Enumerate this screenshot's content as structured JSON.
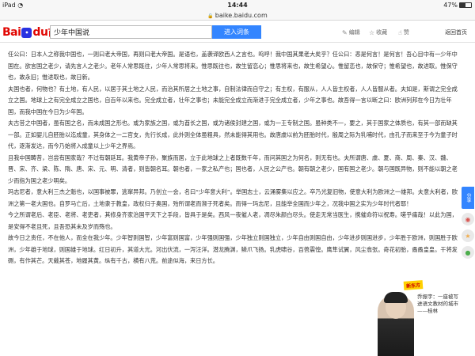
{
  "status_bar": {
    "device": "iPad",
    "wifi_icon": "wifi-icon",
    "time": "14:44",
    "battery_percent": "47%",
    "battery_level": 0.47
  },
  "url_bar": {
    "url": "baike.baidu.com"
  },
  "header": {
    "logo_bai": "Bai",
    "logo_du": "du",
    "logo_baike": "百科",
    "search_value": "少年中国说",
    "search_button": "进入词条",
    "edit_label": "编辑",
    "collect_label": "收藏",
    "like_label": "赞",
    "back_home": "返回首页"
  },
  "article": {
    "paragraphs": [
      "任公曰：日本人之称我中国也，一则曰老大帝国，再则曰老大帝国。是语也，盖袭译欧西人之言也。呜呼！我中国其果老大矣乎？任公曰：恶是何言！是何言！吾心目中有一少年中国在。欲言国之老少，请先言人之老少。老年人常思既往，少年人常思将来。惟思既往也，故生留恋心；惟思将来也，故生希望心。惟留恋也，故保守；惟希望也，故进取。惟保守也，故永旧；惟进取也，故日新。",
      "夫国也者，何物也？有土地，有人民，以居于其土地之人民，而治其所居之土地之事，自制法律而自守之；有主权，有服从，人人皆主权者，人人皆服从者。夫如是，斯谓之完全成立之国。地球上之有完全成立之国也，自百年以来也。完全成立者，壮年之事也；未能完全成立而渐进于完全成立者，少年之事也。故吾得一言以断之曰：欧洲列邦在今日为壮年国，而我中国在今日为少年国。",
      "夫古昔之中国者，虽有国之名，而未成国之形也。或为家族之国，或为酋长之国，或为诸侯封建之国，或为一王专制之国。虽种类不一，要之，其于国家之体质也，有其一部而缺其一部。正如婴儿自胚胎以迄成童，其身体之一二官支，先行长成，此外则全体虽粗具，然未能得其用也。故唐虞以前为胚胎时代，殷周之际为乳哺时代，由孔子而来至于今为童子时代，逐渐发达，而今乃始将入成童以上少年之界焉。",
      "且我中国畴昔，岂尝有国家哉？不过有朝廷耳。我黄帝子孙，聚族而居，立于此地球之上者既数千年，而问其国之为何名，则无有也。夫所谓唐、虞、夏、商、周、秦、汉、魏、晋、宋、齐、梁、陈、隋、唐、宋、元、明、清者，则皆朝名耳。朝也者，一家之私产也；国也者，人民之公产也。朝有朝之老少，国有国之老少。朝与国既异物，则不能以朝之老少而指为国之老少明矣。",
      "玛志尼者，意大利三杰之魁也，以国事被罪，逃窜异邦。乃创立一会，名曰“少年意大利”。举国志士，云涌雾集以应之。卒乃光复旧物，使意大利为欧洲之一雄邦。夫意大利者，欧洲之第一老大国也。自罗马亡后，土地隶于教皇，政权归于奥国，殆所谓老而濒于死者矣。而得一玛志尼，且能举全国而少年之，况我中国之实为少年时代者耶！",
      "今之所谓老后、老臣、老将、老吏者，其修身齐家治国平天下之手段，皆具于是矣。西风一夜催人老，凋尽朱颜白尽头。使走无常当医生，携催命符以祝寿。嗟乎痛哉！以此为国，是安得不老且死，且吾恐其未及岁而殇也。",
      "故今日之责任，不在他人，而全在我少年。少年智则国智，少年富则国富，少年强则国强，少年独立则国独立，少年自由则国自由，少年进步则国进步，少年胜于欧洲，则国胜于欧洲，少年雄于地球，则国雄于地球。红日初升，其道大光。河出伏流，一泻汪洋。潜龙腾渊，鳞爪飞扬。乳虎啸谷，百兽震惶。鹰隼试翼，风尘翕张。奇花初胎，矞矞皇皇。干将发硎，有作其芒。天戴其苍，地履其黄。纵有千古，横有八荒。前途似海，来日方长。"
    ]
  },
  "side_tools": {
    "share_label": "分享",
    "weibo_icon": "weibo-icon",
    "qzone_icon": "qzone-icon",
    "wechat_icon": "wechat-icon"
  },
  "ad": {
    "badge": "新东方",
    "line1": "乔振宇：一座被写",
    "line2": "进语文教材的城市",
    "line3": "——桂林"
  }
}
